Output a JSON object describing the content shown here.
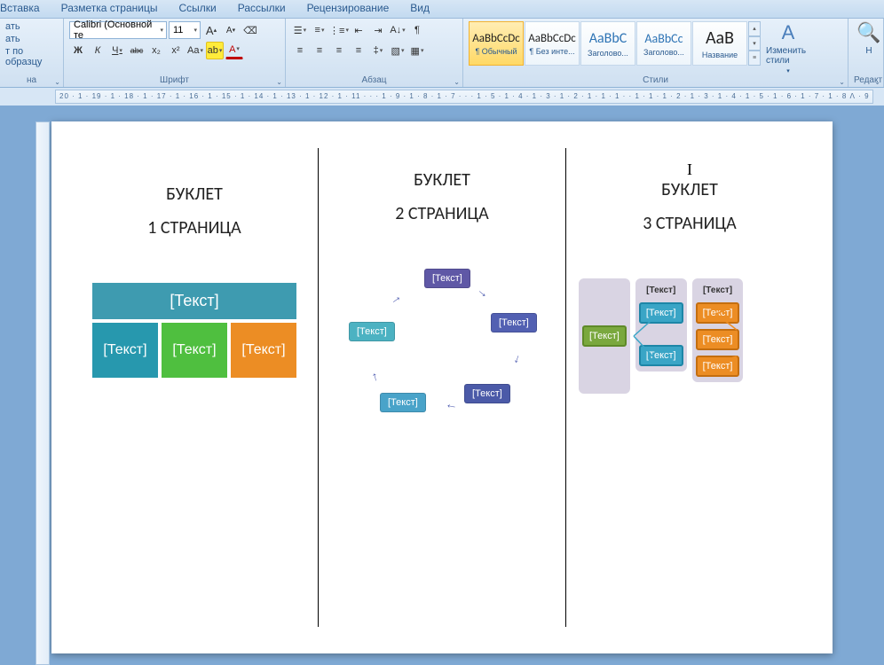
{
  "menu": {
    "items": [
      "Вставка",
      "Разметка страницы",
      "Ссылки",
      "Рассылки",
      "Рецензирование",
      "Вид"
    ]
  },
  "clipboard": {
    "cut": "ать",
    "paste": "ать",
    "format": "т по образцу",
    "na": "на"
  },
  "font": {
    "group": "Шрифт",
    "family": "Calibri (Основной те",
    "size": "11",
    "bold": "Ж",
    "italic": "К",
    "underline": "Ч",
    "strike": "abc",
    "sub": "x₂",
    "sup": "x²",
    "case": "Aa",
    "grow": "A",
    "shrink": "A",
    "clear": "⌫",
    "hl": "ab",
    "color": "A"
  },
  "para": {
    "group": "Абзац"
  },
  "styles": {
    "group": "Стили",
    "items": [
      {
        "prev": "AaBbCcDc",
        "lbl": "¶ Обычный"
      },
      {
        "prev": "AaBbCcDc",
        "lbl": "¶ Без инте..."
      },
      {
        "prev": "AaBbC",
        "lbl": "Заголово..."
      },
      {
        "prev": "AaBbCc",
        "lbl": "Заголово..."
      },
      {
        "prev": "АаВ",
        "lbl": "Название"
      }
    ],
    "change": "Изменить стили",
    "find": "Н",
    "edit": "Редакт"
  },
  "ruler": "20 · 1 · 19 · 1 · 18 · 1 · 17 · 1 · 16 · 1 · 15 · 1 · 14 · 1 · 13 · 1 · 12 · 1 · 11 ·  ·  · 1 · 9 · 1 · 8 · 1 · 7 ·  ·  · 1 · 5 · 1 · 4 · 1 · 3 · 1 · 2 · 1 · 1 · 1 ·  · 1 · 1 · 1 · 2 · 1 · 3 · 1 · 4 · 1 · 5 · 1 · 6 · 1 · 7 · 1 · 8 ᐱ · 9 ·",
  "doc": {
    "c1": {
      "t": "БУКЛЕТ",
      "s": "1 СТРАНИЦА",
      "ph": "[Текст]"
    },
    "c2": {
      "t": "БУКЛЕТ",
      "s": "2 СТРАНИЦА",
      "ph": "[Текст]"
    },
    "c3": {
      "n": "I",
      "t": "БУКЛЕТ",
      "s": "3 СТРАНИЦА",
      "ph": "[Текст]"
    }
  }
}
